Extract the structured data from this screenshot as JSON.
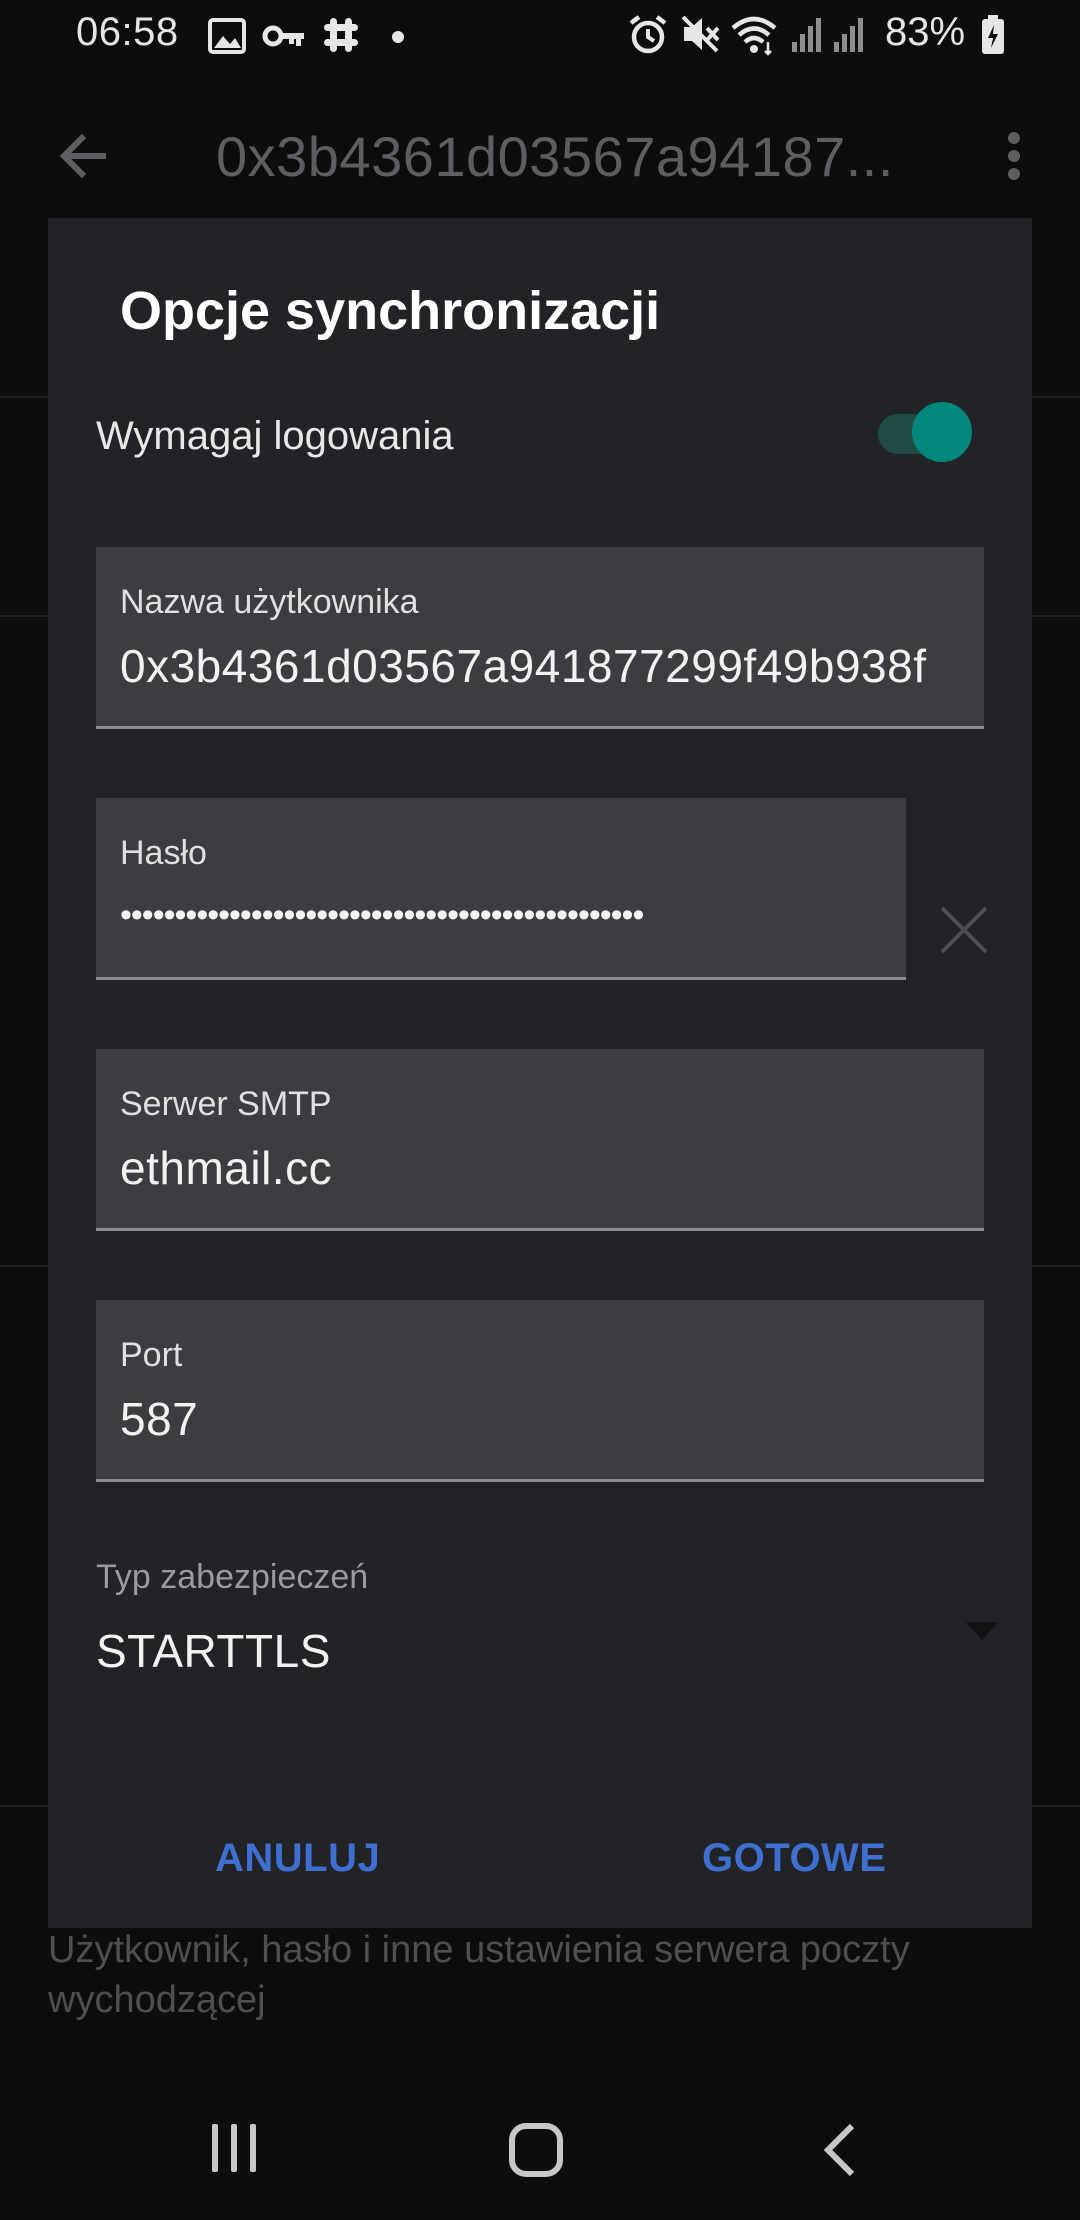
{
  "status_bar": {
    "time": "06:58",
    "battery": "83%",
    "icons": [
      "image-icon",
      "key-icon",
      "slack-icon",
      "dot-icon",
      "alarm-icon",
      "mute-icon",
      "wifi-icon",
      "signal-icon",
      "signal-icon",
      "battery-icon"
    ]
  },
  "app_bar": {
    "title": "0x3b4361d03567a94187..."
  },
  "background": {
    "summary": "Użytkownik, hasło i inne ustawienia serwera poczty wychodzącej"
  },
  "dialog": {
    "title": "Opcje synchronizacji",
    "require_login": {
      "label": "Wymagaj logowania",
      "checked": true
    },
    "username": {
      "label": "Nazwa użytkownika",
      "value": "0x3b4361d03567a941877299f49b938f"
    },
    "password": {
      "label": "Hasło",
      "value": "••••••••••••••••••••••••••••••••••••••••••••••••"
    },
    "smtp_server": {
      "label": "Serwer SMTP",
      "value": "ethmail.cc"
    },
    "port": {
      "label": "Port",
      "value": "587"
    },
    "security": {
      "label": "Typ zabezpieczeń",
      "value": "STARTTLS"
    },
    "buttons": {
      "cancel": "ANULUJ",
      "done": "GOTOWE"
    }
  },
  "colors": {
    "accent": "#00897b",
    "button": "#3f6fd1",
    "dialog_bg": "#222326",
    "field_bg": "#3b3d40"
  }
}
